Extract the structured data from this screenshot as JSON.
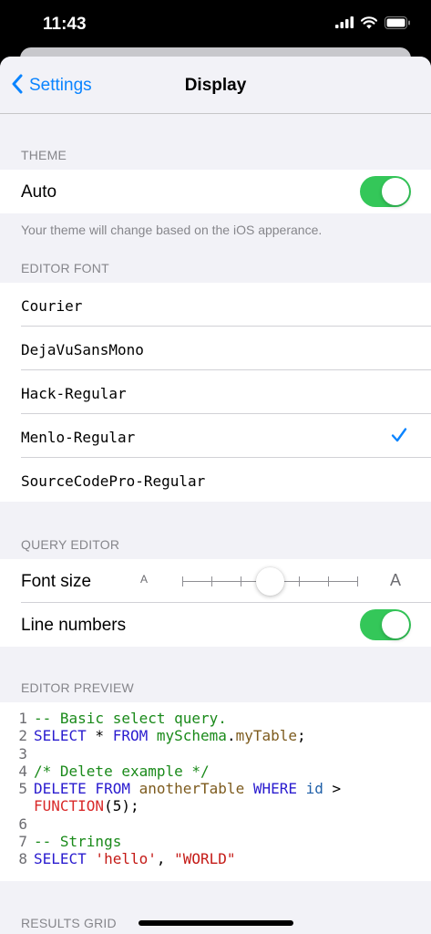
{
  "status_bar": {
    "time": "11:43"
  },
  "nav": {
    "back_label": "Settings",
    "title": "Display"
  },
  "theme": {
    "header": "THEME",
    "auto_label": "Auto",
    "auto_on": true,
    "note": "Your theme will change based on the iOS apperance."
  },
  "editor_font": {
    "header": "EDITOR FONT",
    "fonts": [
      "Courier",
      "DejaVuSansMono",
      "Hack-Regular",
      "Menlo-Regular",
      "SourceCodePro-Regular"
    ],
    "selected": "Menlo-Regular"
  },
  "query_editor": {
    "header": "QUERY EDITOR",
    "font_size_label": "Font size",
    "small_a": "A",
    "large_a": "A",
    "slider_steps": 7,
    "slider_value_fraction": 0.5,
    "line_numbers_label": "Line numbers",
    "line_numbers_on": true
  },
  "preview": {
    "header": "EDITOR PREVIEW",
    "line_numbers": [
      "1",
      "2",
      "3",
      "4",
      "5",
      "",
      "6",
      "7",
      "8"
    ],
    "l1_comment": "-- Basic select query.",
    "l2_select": "SELECT",
    "l2_star": " * ",
    "l2_from": "FROM",
    "l2_schema": " mySchema",
    "l2_dot": ".",
    "l2_table": "myTable",
    "l2_semi": ";",
    "l4_comment": "/* Delete example */",
    "l5_delete": "DELETE",
    "l5_from": " FROM",
    "l5_table": " anotherTable",
    "l5_where": " WHERE",
    "l5_id": " id",
    "l5_gt": " >",
    "l5b_fn": "FUNCTION",
    "l5b_args": "(5);",
    "l7_comment": "-- Strings",
    "l8_select": "SELECT",
    "l8_str1": " 'hello'",
    "l8_comma": ", ",
    "l8_str2": "\"WORLD\""
  },
  "results": {
    "header": "RESULTS GRID"
  },
  "colors": {
    "accent": "#0a84ff",
    "toggle_on": "#34c759"
  }
}
